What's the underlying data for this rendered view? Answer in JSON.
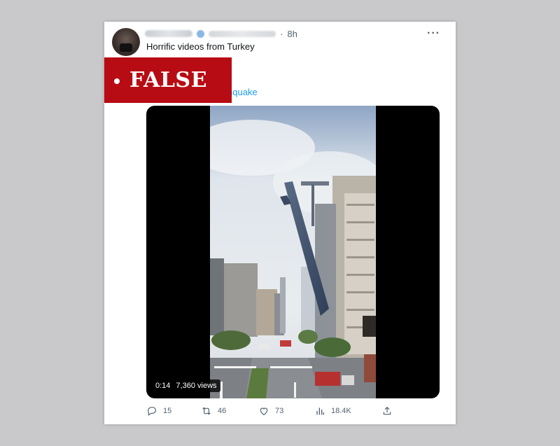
{
  "tweet": {
    "time": "8h",
    "text": "Horrific videos from Turkey",
    "hashtag_fragment": "nquake",
    "more_icon": "more-dots-icon"
  },
  "label": {
    "text": "FALSE",
    "color": "#b80c14"
  },
  "video": {
    "duration": "0:14",
    "views": "7,360 views"
  },
  "actions": {
    "replies": "15",
    "retweets": "46",
    "likes": "73",
    "views": "18.4K",
    "icons": [
      "reply-icon",
      "retweet-icon",
      "like-icon",
      "views-icon",
      "share-icon"
    ]
  },
  "colors": {
    "link": "#1d9bf0",
    "muted": "#536471",
    "text": "#0f1419"
  }
}
